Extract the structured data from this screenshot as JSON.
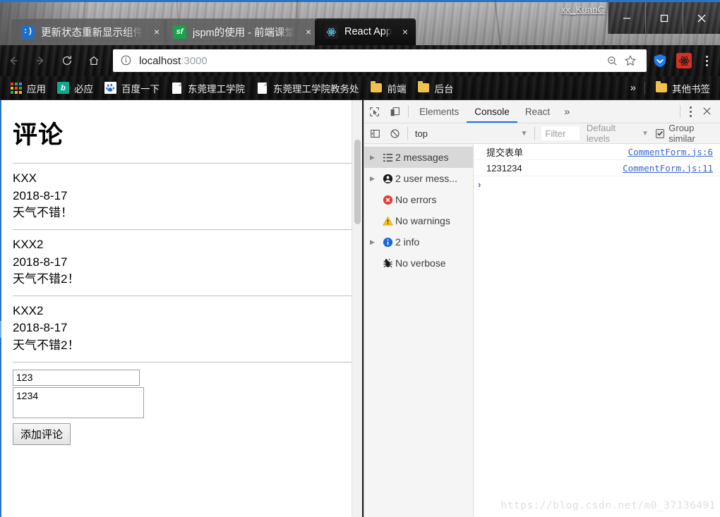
{
  "window": {
    "profile_name": "xx_KuanG",
    "controls": {
      "minimize": "minimize-button",
      "maximize": "maximize-button",
      "close": "close-button"
    }
  },
  "tabs": [
    {
      "title": "更新状态重新显示组件",
      "favicon": ":)",
      "favicon_kind": "smiley-blue",
      "active": false,
      "close": "×"
    },
    {
      "title": "jspm的使用 - 前端课堂",
      "favicon": "sf",
      "favicon_kind": "segmentfault-green",
      "active": false,
      "close": "×"
    },
    {
      "title": "React App",
      "favicon": "atom",
      "favicon_kind": "react-atom",
      "active": true,
      "close": "×"
    }
  ],
  "toolbar": {
    "back": "back-button",
    "forward": "forward-button",
    "reload": "reload-button",
    "home": "home-button",
    "url_host": "localhost",
    "url_port": ":3000",
    "site_info": "info-icon",
    "zoom_out": "zoom-out-icon",
    "bookmark_star": "star-icon",
    "extensions": [
      "tencent-shield",
      "react-devtools"
    ],
    "menu": "chrome-menu-button"
  },
  "bookmarks": {
    "items": [
      {
        "label": "应用",
        "icon": "apps-grid-icon"
      },
      {
        "label": "必应",
        "icon": "bing-icon"
      },
      {
        "label": "百度一下",
        "icon": "baidu-icon"
      },
      {
        "label": "东莞理工学院",
        "icon": "page-icon"
      },
      {
        "label": "东莞理工学院教务处",
        "icon": "page-icon"
      },
      {
        "label": "前端",
        "icon": "folder-icon"
      },
      {
        "label": "后台",
        "icon": "folder-icon"
      }
    ],
    "overflow": "»",
    "other": {
      "label": "其他书签",
      "icon": "folder-icon"
    }
  },
  "page": {
    "heading": "评论",
    "comments": [
      {
        "author": "KXX",
        "date": "2018-8-17",
        "text": "天气不错！"
      },
      {
        "author": "KXX2",
        "date": "2018-8-17",
        "text": "天气不错2！"
      },
      {
        "author": "KXX2",
        "date": "2018-8-17",
        "text": "天气不错2！"
      }
    ],
    "form": {
      "author_value": "123",
      "author_placeholder": "",
      "text_value": "1234",
      "text_placeholder": "",
      "submit_label": "添加评论"
    }
  },
  "devtools": {
    "tabs": [
      {
        "label": "Elements",
        "active": false
      },
      {
        "label": "Console",
        "active": true
      },
      {
        "label": "React",
        "active": false
      }
    ],
    "more_tabs": "»",
    "inspect_icon": "inspect-element-icon",
    "device_icon": "device-toolbar-icon",
    "menu_icon": "devtools-menu-icon",
    "close_icon": "devtools-close-icon",
    "console_toolbar": {
      "sidebar_toggle": "console-sidebar-toggle-icon",
      "clear": "clear-console-icon",
      "context": "top",
      "filter_placeholder": "Filter",
      "levels": "Default levels",
      "group_similar": "Group similar",
      "group_checked": true
    },
    "sidebar": [
      {
        "label": "2 messages",
        "icon": "list-icon",
        "expandable": true,
        "selected": true
      },
      {
        "label": "2 user mess...",
        "icon": "person-icon",
        "expandable": true,
        "selected": false
      },
      {
        "label": "No errors",
        "icon": "error-icon",
        "expandable": false,
        "selected": false
      },
      {
        "label": "No warnings",
        "icon": "warning-icon",
        "expandable": false,
        "selected": false
      },
      {
        "label": "2 info",
        "icon": "info-icon",
        "expandable": true,
        "selected": false
      },
      {
        "label": "No verbose",
        "icon": "bug-icon",
        "expandable": false,
        "selected": false
      }
    ],
    "messages": [
      {
        "text": "提交表单",
        "source": "CommentForm.js:6"
      },
      {
        "text": "1231234",
        "source": "CommentForm.js:11"
      }
    ],
    "prompt": "›",
    "watermark": "https://blog.csdn.net/m0_37136491"
  },
  "colors": {
    "accent": "#1a73e8",
    "tab_active_bg": "#0c0c0c",
    "window_border": "#2b74c4",
    "error": "#d93025",
    "warning": "#f2b600",
    "info": "#1a73e8",
    "link": "#3a66cc"
  }
}
